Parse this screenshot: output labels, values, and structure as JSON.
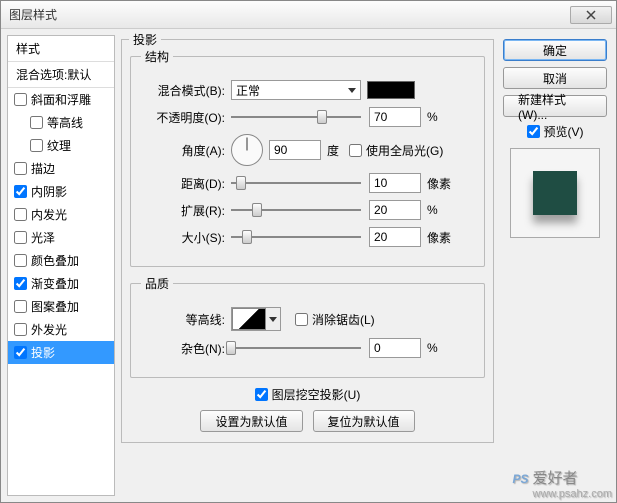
{
  "window": {
    "title": "图层样式"
  },
  "left": {
    "header": "样式",
    "blending": "混合选项:默认",
    "items": [
      {
        "label": "斜面和浮雕",
        "checked": false,
        "indent": false
      },
      {
        "label": "等高线",
        "checked": false,
        "indent": true
      },
      {
        "label": "纹理",
        "checked": false,
        "indent": true
      },
      {
        "label": "描边",
        "checked": false,
        "indent": false
      },
      {
        "label": "内阴影",
        "checked": true,
        "indent": false
      },
      {
        "label": "内发光",
        "checked": false,
        "indent": false
      },
      {
        "label": "光泽",
        "checked": false,
        "indent": false
      },
      {
        "label": "颜色叠加",
        "checked": false,
        "indent": false
      },
      {
        "label": "渐变叠加",
        "checked": true,
        "indent": false
      },
      {
        "label": "图案叠加",
        "checked": false,
        "indent": false
      },
      {
        "label": "外发光",
        "checked": false,
        "indent": false
      },
      {
        "label": "投影",
        "checked": true,
        "indent": false,
        "selected": true
      }
    ]
  },
  "main": {
    "section_title": "投影",
    "structure": {
      "legend": "结构",
      "blend_mode_label": "混合模式(B):",
      "blend_mode_value": "正常",
      "opacity_label": "不透明度(O):",
      "opacity_value": "70",
      "opacity_unit": "%",
      "angle_label": "角度(A):",
      "angle_value": "90",
      "angle_unit": "度",
      "global_light_label": "使用全局光(G)",
      "global_light_checked": false,
      "distance_label": "距离(D):",
      "distance_value": "10",
      "distance_unit": "像素",
      "spread_label": "扩展(R):",
      "spread_value": "20",
      "spread_unit": "%",
      "size_label": "大小(S):",
      "size_value": "20",
      "size_unit": "像素"
    },
    "quality": {
      "legend": "品质",
      "contour_label": "等高线:",
      "antialias_label": "消除锯齿(L)",
      "antialias_checked": false,
      "noise_label": "杂色(N):",
      "noise_value": "0",
      "noise_unit": "%"
    },
    "knockout_label": "图层挖空投影(U)",
    "knockout_checked": true,
    "btn_set_default": "设置为默认值",
    "btn_reset_default": "复位为默认值"
  },
  "right": {
    "ok": "确定",
    "cancel": "取消",
    "new_style": "新建样式(W)...",
    "preview_label": "预览(V)",
    "preview_checked": true
  },
  "watermark": {
    "logo": "PS",
    "cn": "爱好者",
    "url": "www.psahz.com"
  }
}
